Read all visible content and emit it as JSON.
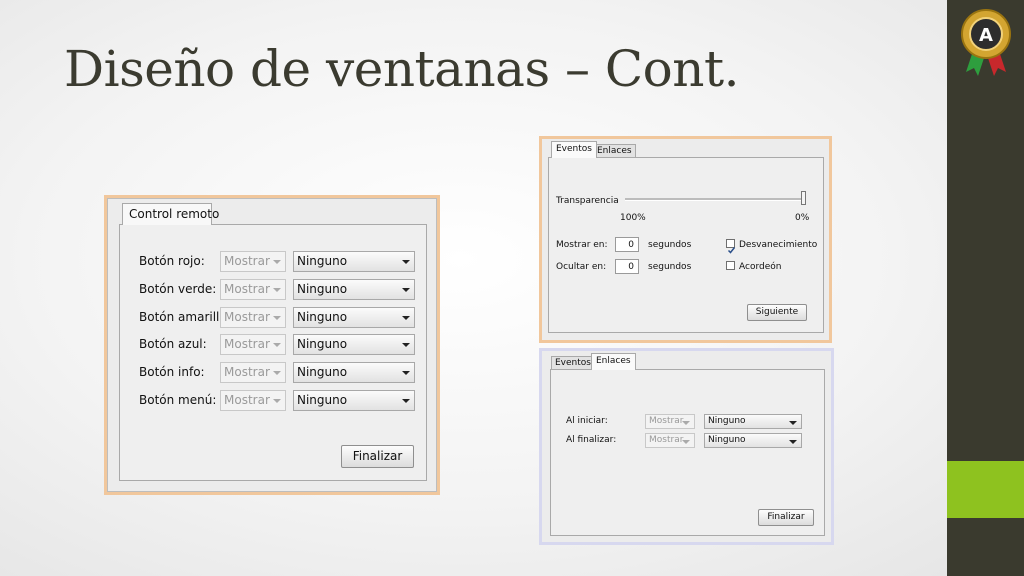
{
  "slide": {
    "title": "Diseño de ventanas – Cont."
  },
  "left_window": {
    "tab": "Control remoto",
    "rows": [
      {
        "label": "Botón rojo:",
        "show": "Mostrar",
        "value": "Ninguno"
      },
      {
        "label": "Botón verde:",
        "show": "Mostrar",
        "value": "Ninguno"
      },
      {
        "label": "Botón amarillo:",
        "show": "Mostrar",
        "value": "Ninguno"
      },
      {
        "label": "Botón azul:",
        "show": "Mostrar",
        "value": "Ninguno"
      },
      {
        "label": "Botón info:",
        "show": "Mostrar",
        "value": "Ninguno"
      },
      {
        "label": "Botón menú:",
        "show": "Mostrar",
        "value": "Ninguno"
      }
    ],
    "finish": "Finalizar"
  },
  "events_window": {
    "tabs": [
      "Eventos",
      "Enlaces"
    ],
    "transparency_label": "Transparencia",
    "transparency_min": "100%",
    "transparency_max": "0%",
    "transparency_value": 0,
    "show_label": "Mostrar en:",
    "show_value": "0",
    "show_unit": "segundos",
    "hide_label": "Ocultar en:",
    "hide_value": "0",
    "hide_unit": "segundos",
    "fade_label": "Desvanecimiento",
    "fade_checked": true,
    "accordion_label": "Acordeón",
    "accordion_checked": false,
    "next": "Siguiente"
  },
  "links_window": {
    "tabs": [
      "Eventos",
      "Enlaces"
    ],
    "rows": [
      {
        "label": "Al iniciar:",
        "show": "Mostrar",
        "value": "Ninguno"
      },
      {
        "label": "Al finalizar:",
        "show": "Mostrar",
        "value": "Ninguno"
      }
    ],
    "finish": "Finalizar"
  },
  "colors": {
    "sidebar": "#3a3a2e",
    "accent_green": "#8ec21f",
    "title": "#3b3b30"
  }
}
